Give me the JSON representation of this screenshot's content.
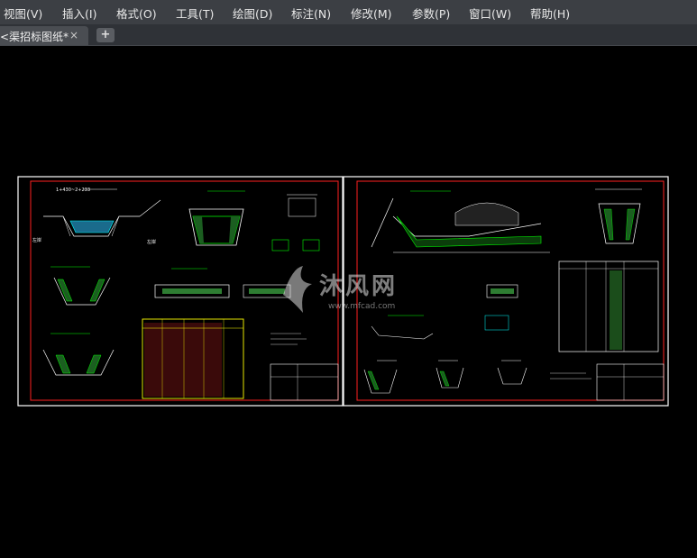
{
  "menubar": {
    "items": [
      {
        "label": "视图(V)"
      },
      {
        "label": "插入(I)"
      },
      {
        "label": "格式(O)"
      },
      {
        "label": "工具(T)"
      },
      {
        "label": "绘图(D)"
      },
      {
        "label": "标注(N)"
      },
      {
        "label": "修改(M)"
      },
      {
        "label": "参数(P)"
      },
      {
        "label": "窗口(W)"
      },
      {
        "label": "帮助(H)"
      }
    ]
  },
  "tabs": {
    "document_label": "<渠招标图纸*",
    "close_icon": "×",
    "new_tab_icon": "+"
  },
  "drawing": {
    "sheet1_title": "1+430~2+233",
    "left_labels": [
      "左岸",
      "左岸"
    ]
  },
  "watermark": {
    "text": "沐风网",
    "url": "www.mfcad.com"
  },
  "colors": {
    "background": "#000000",
    "sheet_border": "#ffffff",
    "frame": "#ff0000",
    "table": "#ffff00",
    "fill": "#00ff00"
  }
}
